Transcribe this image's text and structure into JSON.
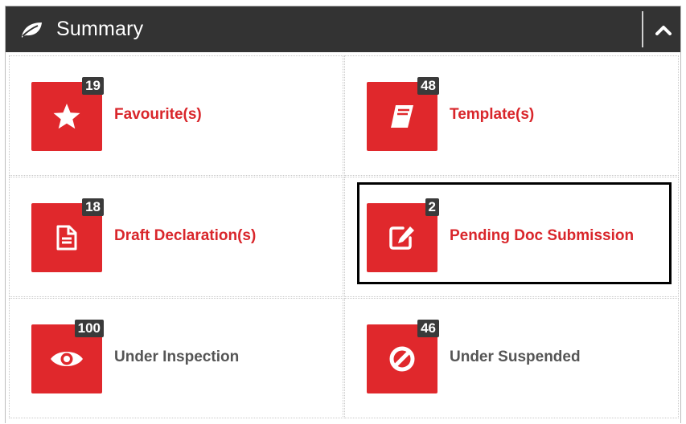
{
  "header": {
    "title": "Summary",
    "leaf_icon": "leaf-icon",
    "collapse_icon": "chevron-up-icon"
  },
  "colors": {
    "header_bg": "#333333",
    "tile_red": "#e0282c",
    "label_red": "#d9262b",
    "label_gray": "#555555",
    "badge_bg": "#3a3a3a"
  },
  "items": [
    {
      "label": "Favourite(s)",
      "count": "19",
      "icon": "star-icon"
    },
    {
      "label": "Template(s)",
      "count": "48",
      "icon": "book-icon"
    },
    {
      "label": "Draft Declaration(s)",
      "count": "18",
      "icon": "document-icon"
    },
    {
      "label": "Pending Doc Submission",
      "count": "2",
      "icon": "edit-icon"
    },
    {
      "label": "Under Inspection",
      "count": "100",
      "icon": "eye-icon"
    },
    {
      "label": "Under Suspended",
      "count": "46",
      "icon": "ban-icon"
    }
  ]
}
